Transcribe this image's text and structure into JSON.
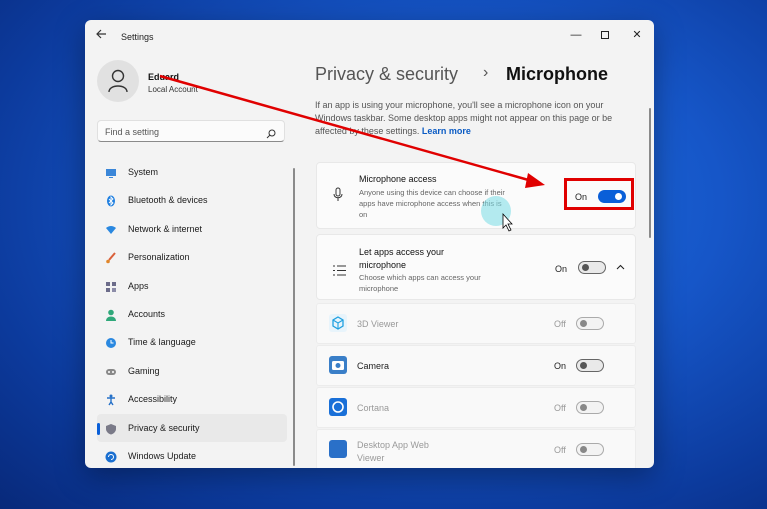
{
  "window": {
    "title": "Settings",
    "minimize": "—",
    "close": "✕"
  },
  "user": {
    "name": "Eduard",
    "account_type": "Local Account"
  },
  "search": {
    "placeholder": "Find a setting"
  },
  "nav": [
    {
      "label": "System",
      "icon": "monitor-icon",
      "color": "#3a86d8"
    },
    {
      "label": "Bluetooth & devices",
      "icon": "bluetooth-icon",
      "color": "#1f7fe0"
    },
    {
      "label": "Network & internet",
      "icon": "wifi-icon",
      "color": "#2a88e0"
    },
    {
      "label": "Personalization",
      "icon": "brush-icon",
      "color": "#d9603a"
    },
    {
      "label": "Apps",
      "icon": "apps-icon",
      "color": "#6c6c8a"
    },
    {
      "label": "Accounts",
      "icon": "person-icon",
      "color": "#2fa87a"
    },
    {
      "label": "Time & language",
      "icon": "globe-clock-icon",
      "color": "#2a88e0"
    },
    {
      "label": "Gaming",
      "icon": "gamepad-icon",
      "color": "#888888"
    },
    {
      "label": "Accessibility",
      "icon": "accessibility-icon",
      "color": "#2470c8"
    },
    {
      "label": "Privacy & security",
      "icon": "shield-icon",
      "color": "#7a7a88",
      "active": true
    },
    {
      "label": "Windows Update",
      "icon": "update-icon",
      "color": "#1a6fd0"
    }
  ],
  "breadcrumb": {
    "parent": "Privacy & security",
    "separator": "›",
    "current": "Microphone"
  },
  "description": {
    "text": "If an app is using your microphone, you'll see a microphone icon on your Windows taskbar. Some desktop apps might not appear on this page or be affected by these settings.",
    "link": "Learn more"
  },
  "microphone_access": {
    "title": "Microphone access",
    "subtitle": "Anyone using this device can choose if their apps have microphone access when this is on",
    "state": "On",
    "enabled": true
  },
  "let_apps_access": {
    "title": "Let apps access your microphone",
    "subtitle": "Choose which apps can access your microphone",
    "state": "On",
    "enabled": false
  },
  "apps": [
    {
      "name": "3D Viewer",
      "state": "Off",
      "dim": true,
      "color": "#1fa0e0"
    },
    {
      "name": "Camera",
      "state": "On",
      "dim": false,
      "color": "#3a7fc8"
    },
    {
      "name": "Cortana",
      "state": "Off",
      "dim": true,
      "color": "#1a70d8"
    },
    {
      "name": "Desktop App Web Viewer",
      "state": "Off",
      "dim": true,
      "color": "#2a70c8"
    }
  ],
  "colors": {
    "accent": "#0a5fd8",
    "annotation": "#e00000"
  }
}
